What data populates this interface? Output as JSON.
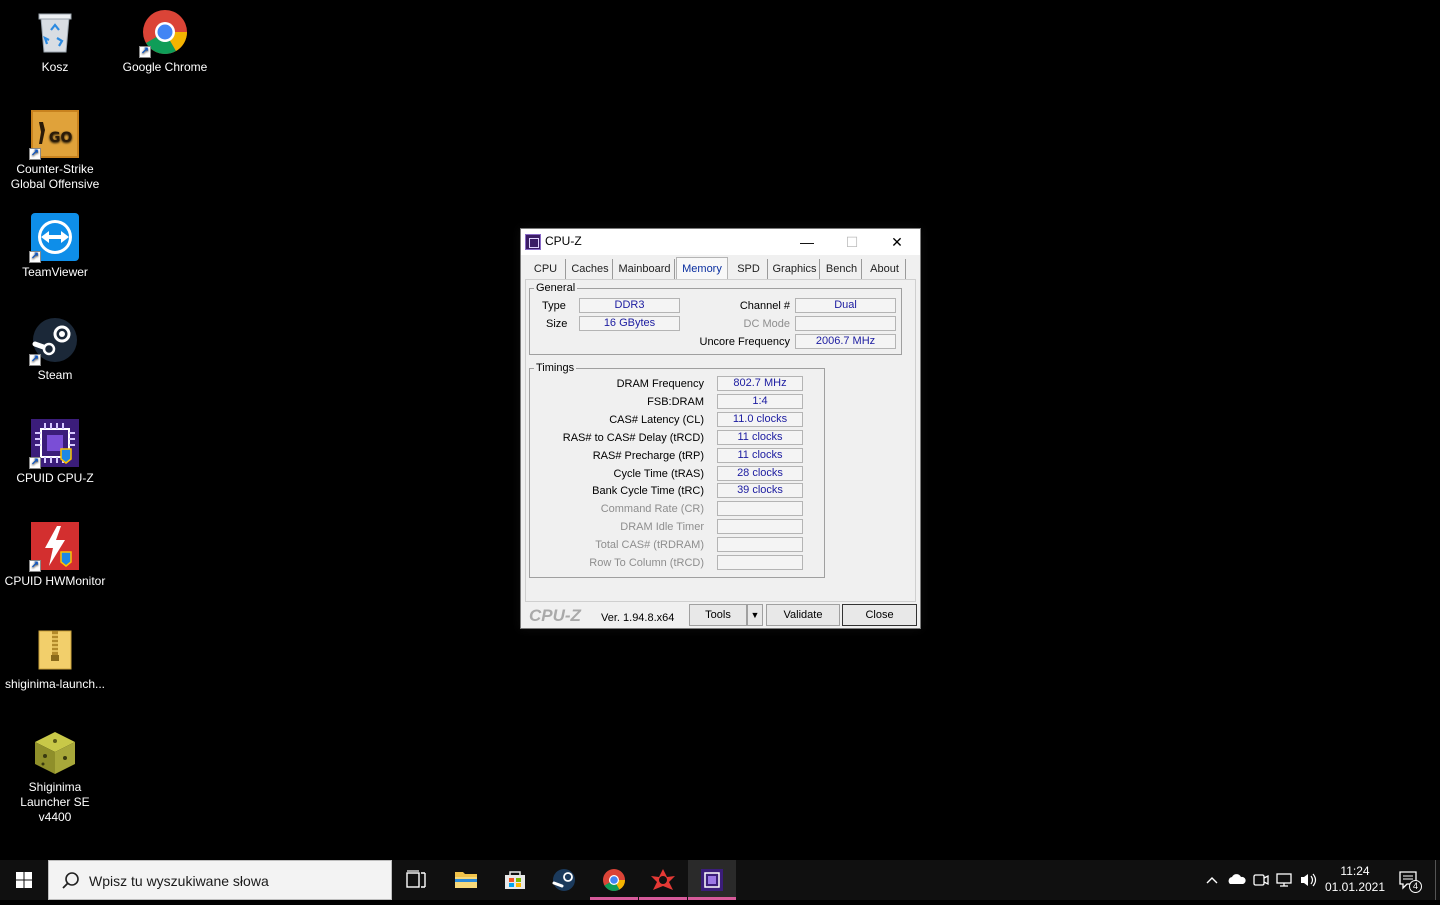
{
  "desktop": {
    "icons": [
      {
        "label": "Kosz",
        "icon": "recycle-bin-icon"
      },
      {
        "label": "Google Chrome",
        "icon": "chrome-icon"
      },
      {
        "label": "Counter-Strike Global Offensive",
        "icon": "csgo-icon"
      },
      {
        "label": "TeamViewer",
        "icon": "teamviewer-icon"
      },
      {
        "label": "Steam",
        "icon": "steam-icon"
      },
      {
        "label": "CPUID CPU-Z",
        "icon": "cpuz-icon"
      },
      {
        "label": "CPUID HWMonitor",
        "icon": "hwmonitor-icon"
      },
      {
        "label": "shiginima-launch...",
        "icon": "zip-folder-icon"
      },
      {
        "label": "Shiginima Launcher SE v4400",
        "icon": "shiginima-icon"
      }
    ]
  },
  "cpuz": {
    "title": "CPU-Z",
    "controls": {
      "minimize": "—",
      "maximize": "☐",
      "close": "✕"
    },
    "tabs": [
      {
        "label": "CPU"
      },
      {
        "label": "Caches"
      },
      {
        "label": "Mainboard"
      },
      {
        "label": "Memory",
        "active": true
      },
      {
        "label": "SPD"
      },
      {
        "label": "Graphics"
      },
      {
        "label": "Bench"
      },
      {
        "label": "About"
      }
    ],
    "general": {
      "legend": "General",
      "type_label": "Type",
      "type_value": "DDR3",
      "size_label": "Size",
      "size_value": "16 GBytes",
      "channel_label": "Channel #",
      "channel_value": "Dual",
      "dcmode_label": "DC Mode",
      "dcmode_value": "",
      "uncore_label": "Uncore Frequency",
      "uncore_value": "2006.7 MHz"
    },
    "timings": {
      "legend": "Timings",
      "rows": [
        {
          "label": "DRAM Frequency",
          "value": "802.7 MHz",
          "enabled": true
        },
        {
          "label": "FSB:DRAM",
          "value": "1:4",
          "enabled": true
        },
        {
          "label": "CAS# Latency (CL)",
          "value": "11.0 clocks",
          "enabled": true
        },
        {
          "label": "RAS# to CAS# Delay (tRCD)",
          "value": "11 clocks",
          "enabled": true
        },
        {
          "label": "RAS# Precharge (tRP)",
          "value": "11 clocks",
          "enabled": true
        },
        {
          "label": "Cycle Time (tRAS)",
          "value": "28 clocks",
          "enabled": true
        },
        {
          "label": "Bank Cycle Time (tRC)",
          "value": "39 clocks",
          "enabled": true
        },
        {
          "label": "Command Rate (CR)",
          "value": "",
          "enabled": false
        },
        {
          "label": "DRAM Idle Timer",
          "value": "",
          "enabled": false
        },
        {
          "label": "Total CAS# (tRDRAM)",
          "value": "",
          "enabled": false
        },
        {
          "label": "Row To Column (tRCD)",
          "value": "",
          "enabled": false
        }
      ]
    },
    "footer": {
      "logo": "CPU-Z",
      "version": "Ver. 1.94.8.x64",
      "tools_label": "Tools",
      "tools_arrow": "▼",
      "validate_label": "Validate",
      "close_label": "Close"
    }
  },
  "taskbar": {
    "search_placeholder": "Wpisz tu wyszukiwane słowa",
    "apps": [
      "task-view-icon",
      "file-explorer-icon",
      "store-icon",
      "steam-icon",
      "chrome-icon",
      "hwmonitor-icon",
      "cpuz-icon"
    ],
    "tray": {
      "time": "11:24",
      "date": "01.01.2021",
      "notification_count": "4"
    }
  }
}
